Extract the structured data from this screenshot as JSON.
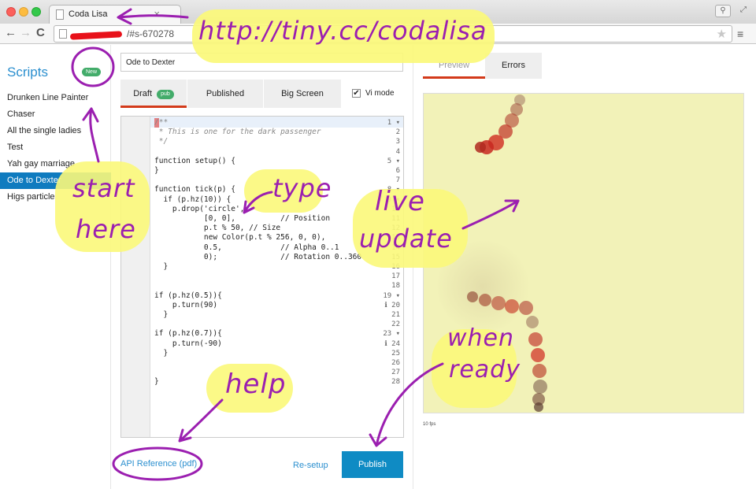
{
  "browser": {
    "tab_title": "Coda Lisa",
    "tab_close": "×",
    "url": "/#s-670278",
    "nav_back": "←",
    "nav_forward": "→",
    "reload": "C",
    "bookmark_star": "★",
    "menu": "≡",
    "profile_btn": "⚲",
    "fullscreen_btn": "⤢"
  },
  "sidebar": {
    "title": "Scripts",
    "new_badge": "New",
    "items": [
      {
        "label": "Drunken Line Painter"
      },
      {
        "label": "Chaser"
      },
      {
        "label": "All the single ladies"
      },
      {
        "label": "Test"
      },
      {
        "label": "Yah gay marriage"
      },
      {
        "label": "Ode to Dexter"
      },
      {
        "label": "Higs particle"
      }
    ],
    "active_index": 5
  },
  "editor": {
    "script_name": "Ode to Dexter",
    "tabs": [
      {
        "label": "Draft",
        "badge": "pub"
      },
      {
        "label": "Published"
      },
      {
        "label": "Big Screen"
      }
    ],
    "vi_mode_label": "Vi mode",
    "vi_mode_checked": "✔",
    "gutter": [
      "1 ▾",
      "2",
      "3",
      "4",
      "5 ▾",
      "6",
      "7",
      "8 ▾",
      "9 ▾",
      "10",
      "11",
      "12",
      "13",
      "14",
      "15",
      "16",
      "17",
      "18",
      "19 ▾",
      "ℹ 20",
      "21",
      "22",
      "23 ▾",
      "ℹ 24",
      "25",
      "26",
      "27",
      "28"
    ],
    "code_lines": [
      "/**",
      " * This is one for the dark passenger",
      " */",
      "",
      "function setup() {",
      "}",
      "",
      "function tick(p) {",
      "  if (p.hz(10)) {",
      "    p.drop('circle',",
      "           [0, 0],          // Position",
      "           p.t % 50, // Size",
      "           new Color(p.t % 256, 0, 0),",
      "           0.5,             // Alpha 0..1",
      "           0);              // Rotation 0..360",
      "  }",
      "",
      "",
      "if (p.hz(0.5)){",
      "    p.turn(90)",
      "  }",
      "",
      "if (p.hz(0.7)){",
      "    p.turn(-90)",
      "  }",
      "",
      "",
      "}"
    ],
    "api_reference_label": "API Reference (pdf)",
    "resetup_label": "Re-setup",
    "publish_label": "Publish"
  },
  "preview": {
    "tabs": [
      {
        "label": "Preview"
      },
      {
        "label": "Errors"
      }
    ],
    "fps": "10 fps",
    "canvas_color": "#f2f2b8"
  },
  "annotations": {
    "url": "http://tiny.cc/codalisa",
    "start_line1": "start",
    "start_line2": "here",
    "type": "type",
    "live_line1": "live",
    "live_line2": "update",
    "help": "help",
    "when_line1": "when",
    "when_line2": "ready"
  },
  "colors": {
    "accent": "#2b8fcf",
    "active_item": "#0f7bbf",
    "badge_green": "#43ac6a",
    "tab_underline": "#d33a1a",
    "annotation_ink": "#9b1fb0",
    "highlighter": "#fbf87a"
  }
}
